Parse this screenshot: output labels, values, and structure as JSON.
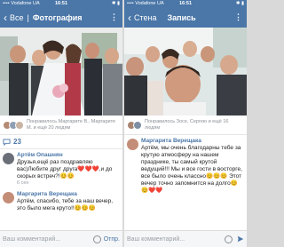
{
  "left": {
    "status": {
      "carrier": "•••• Vodafone UA",
      "time": "16:51",
      "battery": "✱ ▮"
    },
    "nav": {
      "title_main": "Все",
      "title_section": "Фотография"
    },
    "likes": {
      "text": "Понравилось Маргарите В., Маргарите М. и ещё 20 людям"
    },
    "actions": {
      "count": "23"
    },
    "comments": [
      {
        "name": "Артём Опашнян",
        "text": "Друзья,ещё раз поздравляю вас)Любите друг друга❤️❤️❤️,и до скорых встреч?!😊😊",
        "date": "6 сен"
      },
      {
        "name": "Маргарита Верещака",
        "text": "Артём, спасибо, тебе за наш вечер, это было мега круто!!😊😊😊",
        "date": ""
      }
    ],
    "input": {
      "placeholder": "Ваш комментарий...",
      "send": "Отпр."
    }
  },
  "right": {
    "status": {
      "carrier": "•••• Vodafone UA",
      "time": "16:51",
      "battery": "✱ ▮"
    },
    "nav": {
      "title_main": "Стена",
      "title_section": "Запись"
    },
    "likes": {
      "text": "Понравилось Зосе, Сергею и ещё 16 людям"
    },
    "comments": [
      {
        "name": "Маргарита Верещака",
        "text": "Артём, мы очень благодарны тебе за крутую атмосферу на нашем празднике, ты самый крутой ведущий!!! Мы и все гости в восторге, все было очень классно😊😊😊 Этот вечер точно запомнится на долго😊😊❤️❤️",
        "date": ""
      }
    ],
    "input": {
      "placeholder": "Ваш комментарий..."
    }
  },
  "colors": {
    "accent": "#4a76a8",
    "muted": "#8a8f96",
    "text": "#222222"
  },
  "icons": [
    "back-chevron-icon",
    "more-icon",
    "comment-icon",
    "emoji-icon",
    "send-icon"
  ]
}
